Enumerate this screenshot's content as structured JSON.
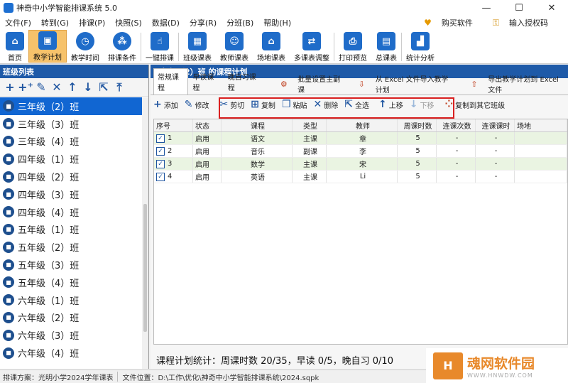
{
  "window": {
    "title": "神奇中小学智能排课系统 5.0"
  },
  "menu": {
    "items": [
      "文件(F)",
      "转到(G)",
      "排课(P)",
      "快照(S)",
      "数据(D)",
      "分享(R)",
      "分班(B)",
      "帮助(H)"
    ],
    "buy": "购买软件",
    "license": "输入授权码"
  },
  "toolbar": {
    "buttons": [
      "首页",
      "教学计划",
      "教学时间",
      "排课条件",
      "一键排课",
      "班级课表",
      "教师课表",
      "场地课表",
      "多课表调整",
      "打印预览",
      "总课表",
      "统计分析"
    ]
  },
  "left": {
    "title": "班级列表",
    "classes": [
      "三年级（2）班",
      "三年级（3）班",
      "三年级（4）班",
      "四年级（1）班",
      "四年级（2）班",
      "四年级（3）班",
      "四年级（4）班",
      "五年级（1）班",
      "五年级（2）班",
      "五年级（3）班",
      "五年级（4）班",
      "六年级（1）班",
      "六年级（2）班",
      "六年级（3）班",
      "六年级（4）班"
    ]
  },
  "right": {
    "title": "三年级（2）班 的课程计划",
    "tabs": [
      "常规课程",
      "早读课程",
      "晚自习课程"
    ],
    "batch": "批量设置主副课",
    "import": "从 Excel 文件导入教学计划",
    "export": "导出教学计划到 Excel 文件",
    "actions": {
      "add": "添加",
      "edit": "修改",
      "cut": "剪切",
      "copy": "复制",
      "paste": "粘贴",
      "delete": "删除",
      "selectall": "全选",
      "up": "上移",
      "down": "下移",
      "copyto": "复制到其它班级"
    },
    "columns": [
      "序号",
      "状态",
      "课程",
      "类型",
      "教师",
      "周课时数",
      "连课次数",
      "连课课时",
      "场地"
    ],
    "rows": [
      {
        "seq": "1",
        "status": "启用",
        "course": "语文",
        "type": "主课",
        "teacher": "章",
        "weekly": "5",
        "cont": "-",
        "conth": "-",
        "venue": ""
      },
      {
        "seq": "2",
        "status": "启用",
        "course": "音乐",
        "type": "副课",
        "teacher": "李",
        "weekly": "5",
        "cont": "-",
        "conth": "-",
        "venue": ""
      },
      {
        "seq": "3",
        "status": "启用",
        "course": "数学",
        "type": "主课",
        "teacher": "宋",
        "weekly": "5",
        "cont": "-",
        "conth": "-",
        "venue": ""
      },
      {
        "seq": "4",
        "status": "启用",
        "course": "英语",
        "type": "主课",
        "teacher": "Li",
        "weekly": "5",
        "cont": "-",
        "conth": "-",
        "venue": ""
      }
    ],
    "stats": "课程计划统计：周课时数 20/35，早读 0/5，晚自习 0/10"
  },
  "status": {
    "scheme": "排课方案：光明小学2024学年课表",
    "file": "文件位置：D:\\工作\\优化\\神奇中小学智能排课系统\\2024.sqpk"
  },
  "watermark": {
    "name": "魂网软件园",
    "url": "WWW.HNWDW.COM"
  }
}
